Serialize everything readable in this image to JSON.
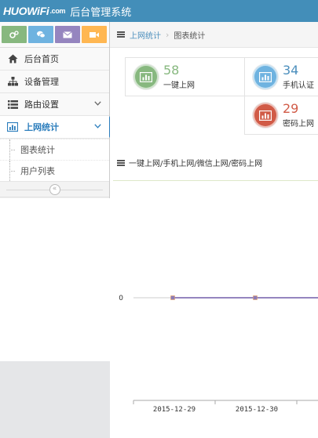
{
  "app": {
    "logo_text": "HUOWiFi",
    "logo_suffix": ".com",
    "title": "后台管理系统"
  },
  "shortcuts": [
    {
      "icon": "cogs-icon",
      "color": "#87b87f"
    },
    {
      "icon": "wechat-icon",
      "color": "#6fb3e0"
    },
    {
      "icon": "mail-icon",
      "color": "#9585bf"
    },
    {
      "icon": "video-icon",
      "color": "#ffb752"
    }
  ],
  "sidebar": {
    "items": [
      {
        "label": "后台首页",
        "icon": "home-icon"
      },
      {
        "label": "设备管理",
        "icon": "sitemap-icon"
      },
      {
        "label": "路由设置",
        "icon": "list-icon"
      },
      {
        "label": "上网统计",
        "icon": "bar-chart-icon"
      }
    ],
    "subitems": [
      {
        "label": "图表统计"
      },
      {
        "label": "用户列表"
      }
    ],
    "collapse_label": "«"
  },
  "breadcrumb": {
    "parent": "上网统计",
    "separator": "›",
    "current": "图表统计"
  },
  "stats": [
    {
      "value": "58",
      "label": "一键上网",
      "color": "#87b87f",
      "value_color": "#87b87f"
    },
    {
      "value": "34",
      "label": "手机认证",
      "color": "#6fb3e0",
      "value_color": "#4c8fbd"
    },
    {
      "value": "29",
      "label": "密码上网",
      "color": "#d15b47",
      "value_color": "#d15b47"
    }
  ],
  "chart_section": {
    "title": "一键上网/手机上网/微信上网/密码上网"
  },
  "chart_data": {
    "type": "line",
    "categories": [
      "2015-12-29",
      "2015-12-30"
    ],
    "series": [
      {
        "values": [
          0,
          0
        ],
        "color": "#9585bf"
      }
    ],
    "y_tick_labels": [
      "0"
    ],
    "xlabel": "",
    "ylabel": ""
  }
}
